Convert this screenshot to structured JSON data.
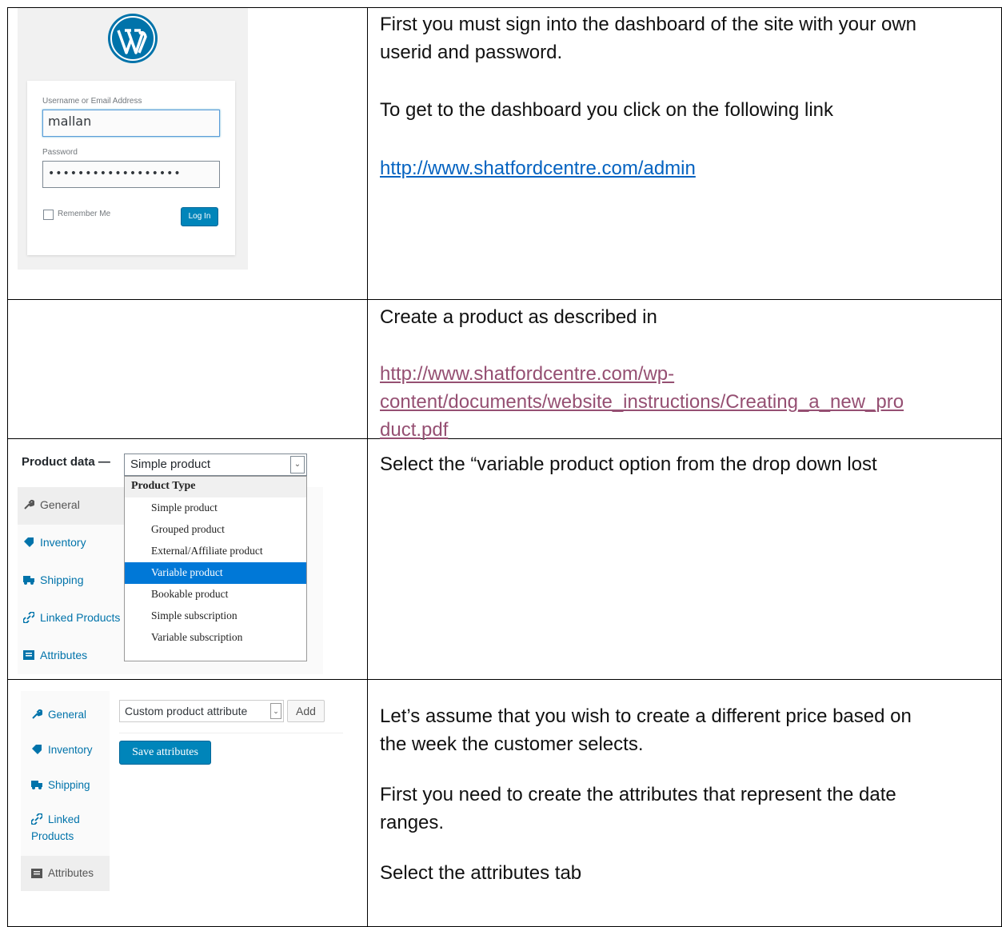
{
  "row1": {
    "login": {
      "username_label": "Username or Email Address",
      "username_value": "mallan",
      "password_label": "Password",
      "password_value": "••••••••••••••••••",
      "remember_label": "Remember Me",
      "login_button": "Log In",
      "logo_icon": "wordpress-logo-icon"
    },
    "text": {
      "line1": "First you must sign into the dashboard of the site with your own",
      "line2": "userid and password.",
      "line3": "To get to the dashboard you click on the following link",
      "link": "http://www.shatfordcentre.com/admin"
    }
  },
  "row2": {
    "text": {
      "line1": "Create a product as described in",
      "link_line1": "http://www.shatfordcentre.com/wp-",
      "link_line2": "content/documents/website_instructions/Creating_a_new_pro",
      "link_line3": "duct.pdf"
    }
  },
  "row3": {
    "product_data_label": "Product data —",
    "selected_type": "Simple product",
    "dropdown_group": "Product Type",
    "options": [
      "Simple product",
      "Grouped product",
      "External/Affiliate product",
      "Variable product",
      "Bookable product",
      "Simple subscription",
      "Variable subscription"
    ],
    "highlighted_option": "Variable product",
    "tabs": [
      "General",
      "Inventory",
      "Shipping",
      "Linked Products",
      "Attributes"
    ],
    "text": "Select the “variable product option from the drop down lost"
  },
  "row4": {
    "tabs": [
      "General",
      "Inventory",
      "Shipping",
      "Linked",
      "Products",
      "Attributes"
    ],
    "attribute_select": "Custom product attribute",
    "add_button": "Add",
    "save_button": "Save attributes",
    "text": {
      "line1": "Let’s assume that you wish to create a different price based on",
      "line2": "the week the customer selects.",
      "line3": "First you need to create the attributes that represent the date",
      "line4": "ranges.",
      "line5": "Select the attributes tab"
    }
  },
  "colors": {
    "link_blue": "#0563c1",
    "link_visited": "#954f72",
    "wp_blue": "#0085ba",
    "highlight": "#0078d7"
  }
}
